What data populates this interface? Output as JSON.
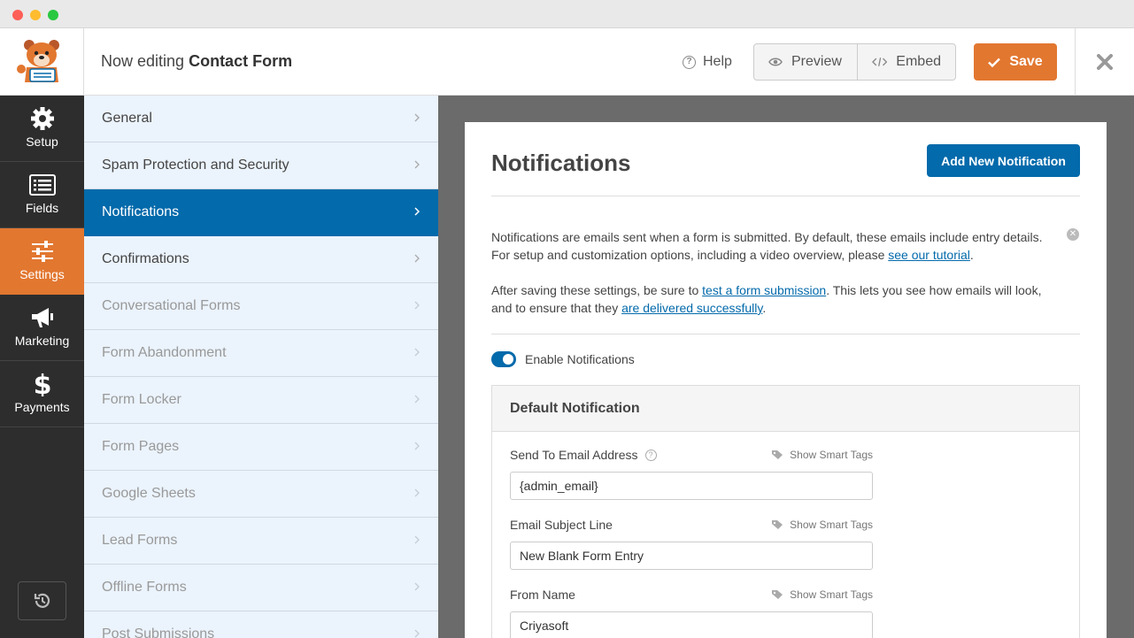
{
  "header": {
    "title_prefix": "Now editing",
    "form_name": "Contact Form",
    "help_label": "Help",
    "preview_label": "Preview",
    "embed_label": "Embed",
    "save_label": "Save"
  },
  "rail": {
    "items": [
      {
        "label": "Setup",
        "icon": "gear-icon"
      },
      {
        "label": "Fields",
        "icon": "list-icon"
      },
      {
        "label": "Settings",
        "icon": "sliders-icon",
        "active": true
      },
      {
        "label": "Marketing",
        "icon": "megaphone-icon"
      },
      {
        "label": "Payments",
        "icon": "dollar-icon"
      }
    ],
    "revisions_icon": "history-icon"
  },
  "settings_menu": {
    "items": [
      {
        "label": "General"
      },
      {
        "label": "Spam Protection and Security"
      },
      {
        "label": "Notifications",
        "active": true
      },
      {
        "label": "Confirmations"
      },
      {
        "label": "Conversational Forms"
      },
      {
        "label": "Form Abandonment"
      },
      {
        "label": "Form Locker"
      },
      {
        "label": "Form Pages"
      },
      {
        "label": "Google Sheets"
      },
      {
        "label": "Lead Forms"
      },
      {
        "label": "Offline Forms"
      },
      {
        "label": "Post Submissions"
      }
    ]
  },
  "panel": {
    "title": "Notifications",
    "add_button": "Add New Notification",
    "notice": {
      "p1_text": "Notifications are emails sent when a form is submitted. By default, these emails include entry details. For setup and customization options, including a video overview, please ",
      "p1_link": "see our tutorial",
      "p1_end": ".",
      "p2_text": "After saving these settings, be sure to ",
      "p2_link1": "test a form submission",
      "p2_mid": ". This lets you see how emails will look, and to ensure that they ",
      "p2_link2": "are delivered successfully",
      "p2_end": "."
    },
    "toggle_label": "Enable Notifications",
    "notification": {
      "heading": "Default Notification",
      "smart_tags_label": "Show Smart Tags",
      "fields": [
        {
          "label": "Send To Email Address",
          "value": "{admin_email}",
          "help": true
        },
        {
          "label": "Email Subject Line",
          "value": "New Blank Form Entry",
          "help": false
        },
        {
          "label": "From Name",
          "value": "Criyasoft",
          "help": false
        }
      ]
    }
  },
  "colors": {
    "accent_orange": "#e27730",
    "accent_blue": "#036aab",
    "rail_bg": "#2d2d2d",
    "submenu_bg": "#ebf3fc"
  }
}
